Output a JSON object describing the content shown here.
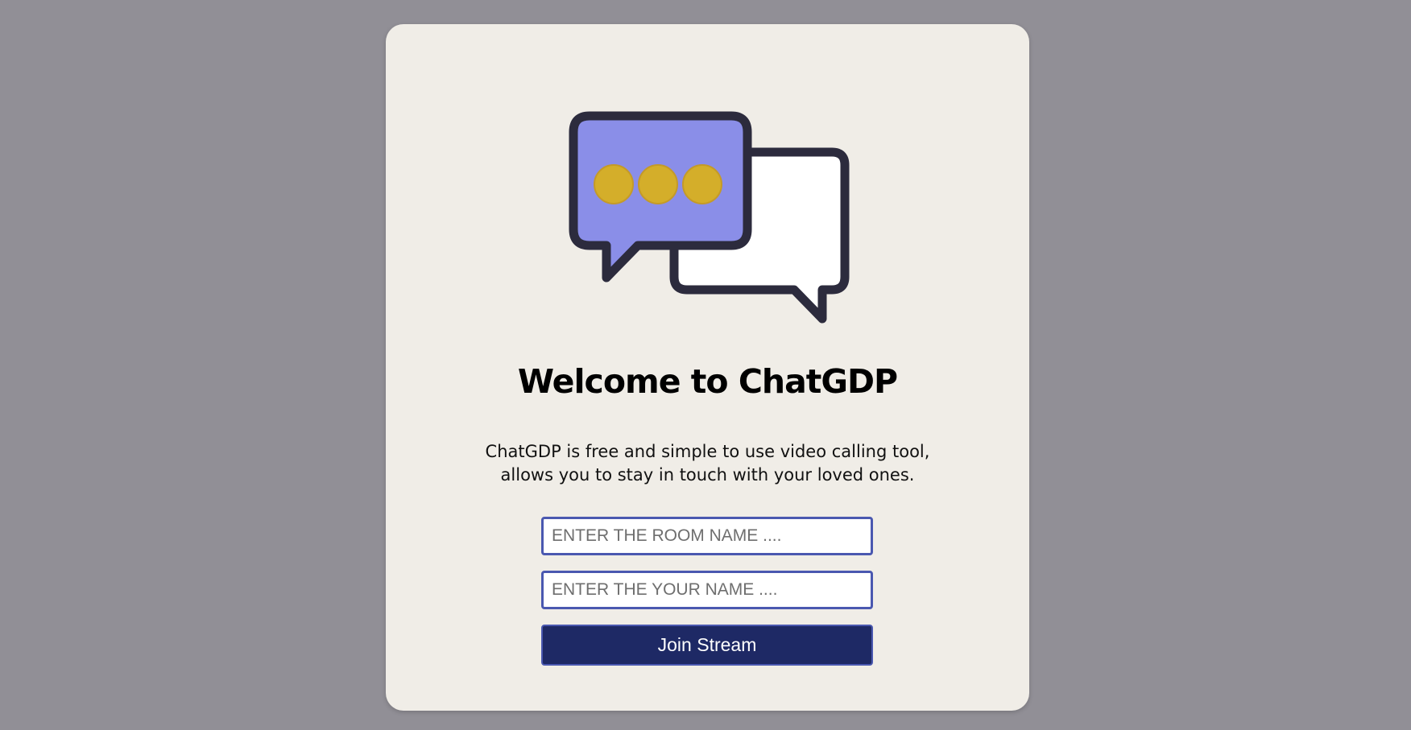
{
  "page": {
    "title": "Welcome to ChatGDP",
    "description": "ChatGDP is free and simple to use video calling tool, allows you to stay in touch with your loved ones."
  },
  "logo": {
    "icon": "chat-bubbles-icon",
    "colors": {
      "outline": "#2c2b3d",
      "front_bubble": "#8a8ee8",
      "back_bubble": "#ffffff",
      "dots": "#d4ae2a"
    }
  },
  "form": {
    "room_placeholder": "ENTER THE ROOM NAME ....",
    "room_value": "",
    "name_placeholder": "ENTER THE YOUR NAME ....",
    "name_value": "",
    "join_label": "Join Stream"
  },
  "colors": {
    "background": "#918f96",
    "card": "#f0ede7",
    "input_border": "#4a58b0",
    "button": "#1e2965"
  }
}
